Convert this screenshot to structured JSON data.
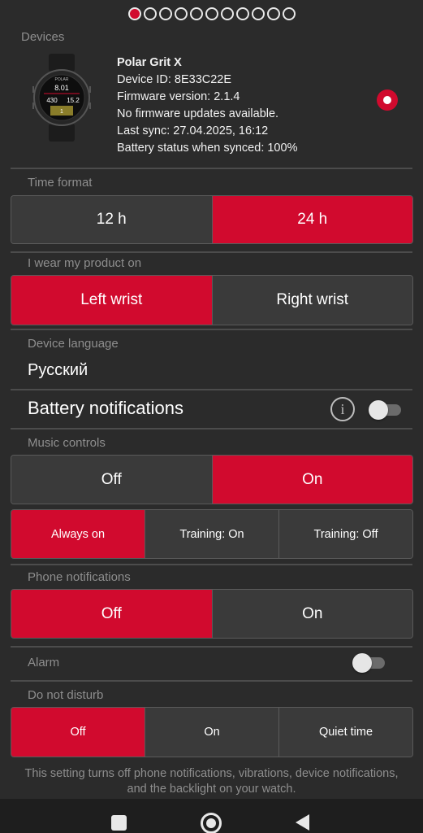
{
  "pager": {
    "count": 11,
    "active_index": 0
  },
  "devices": {
    "label": "Devices",
    "device_name": "Polar Grit X",
    "device_id": "Device ID: 8E33C22E",
    "firmware_version": "Firmware version: 2.1.4",
    "firmware_status": "No firmware updates available.",
    "last_sync": "Last sync: 27.04.2025, 16:12",
    "battery_status": "Battery status when synced: 100%",
    "watch_face": {
      "brand": "POLAR",
      "line1": "8.01",
      "line2_left": "430",
      "line2_right": "15.2",
      "line3": "1"
    },
    "selected": true
  },
  "time_format": {
    "label": "Time format",
    "options": [
      "12 h",
      "24 h"
    ],
    "selected": 1
  },
  "wrist": {
    "label": "I wear my product on",
    "options": [
      "Left wrist",
      "Right wrist"
    ],
    "selected": 0
  },
  "language": {
    "label": "Device language",
    "value": "Русский"
  },
  "battery_notifications": {
    "label": "Battery notifications",
    "info_icon": "info-icon",
    "enabled": false
  },
  "music_controls": {
    "label": "Music controls",
    "options": [
      "Off",
      "On"
    ],
    "selected": 1,
    "mode_options": [
      "Always on",
      "Training: On",
      "Training: Off"
    ],
    "mode_selected": 0
  },
  "phone_notifications": {
    "label": "Phone notifications",
    "options": [
      "Off",
      "On"
    ],
    "selected": 0
  },
  "alarm": {
    "label": "Alarm",
    "enabled": false
  },
  "do_not_disturb": {
    "label": "Do not disturb",
    "options": [
      "Off",
      "On",
      "Quiet time"
    ],
    "selected": 0,
    "note": "This setting turns off phone notifications, vibrations, device notifications, and the backlight on your watch."
  },
  "navbar": {
    "icons": [
      "recents-icon",
      "home-icon",
      "back-icon"
    ]
  },
  "colors": {
    "accent": "#d10a2e",
    "background": "#2b2b2b",
    "control": "#3a3a3a"
  }
}
